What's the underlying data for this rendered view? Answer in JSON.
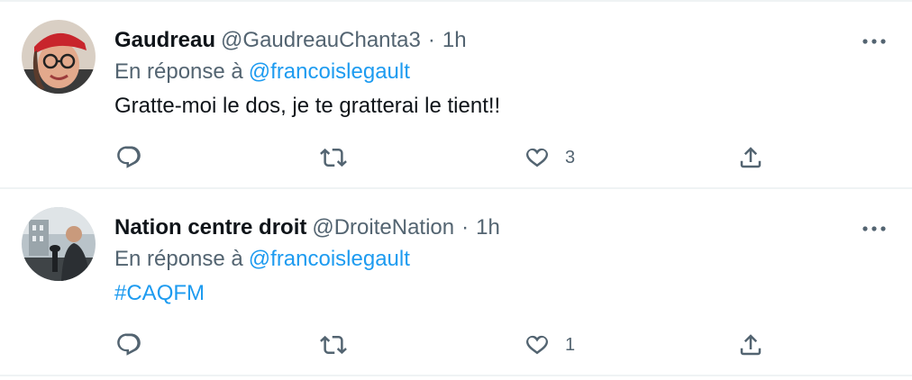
{
  "colors": {
    "link": "#1d9bf0",
    "secondary_text": "#536471",
    "primary_text": "#0f1419",
    "divider": "#eff3f4"
  },
  "tweets": [
    {
      "display_name": "Gaudreau",
      "handle": "@GaudreauChanta3",
      "separator": "·",
      "time": "1h",
      "reply_prefix": "En réponse à",
      "reply_to": "@francoislegault",
      "text": "Gratte-moi le dos, je te gratterai le tient!!",
      "text_is_hashtag": false,
      "avatar_icon": "avatar-woman-red-bandana",
      "likes": "3"
    },
    {
      "display_name": "Nation centre droit",
      "handle": "@DroiteNation",
      "separator": "·",
      "time": "1h",
      "reply_prefix": "En réponse à",
      "reply_to": "@francoislegault",
      "text": "#CAQFM",
      "text_is_hashtag": true,
      "avatar_icon": "avatar-speaker-photo",
      "likes": "1"
    }
  ],
  "icons": {
    "reply": "reply-icon",
    "retweet": "retweet-icon",
    "like": "heart-icon",
    "share": "share-icon",
    "more": "more-icon"
  }
}
